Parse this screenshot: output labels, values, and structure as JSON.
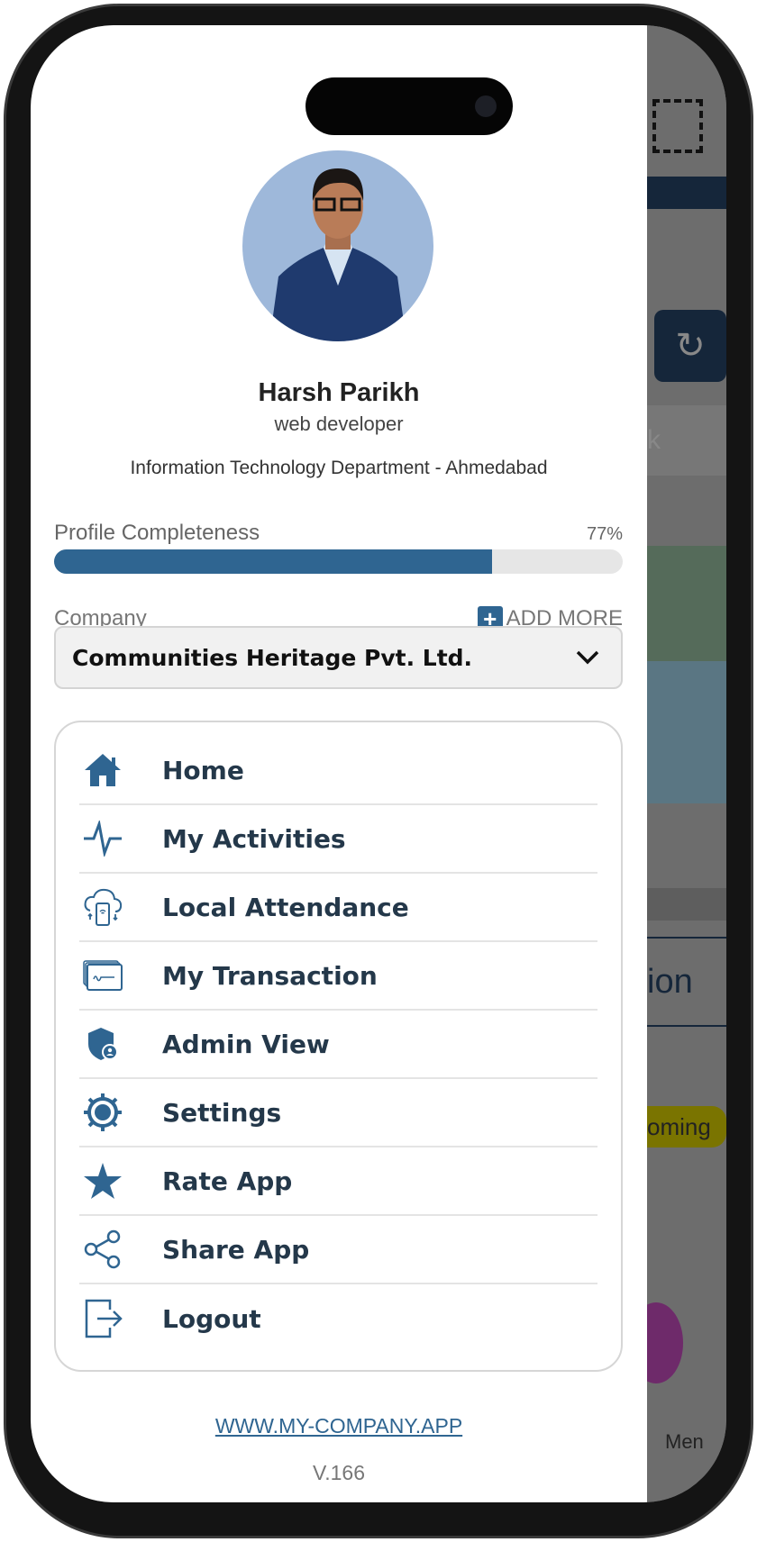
{
  "profile": {
    "name": "Harsh Parikh",
    "role": "web developer",
    "department": "Information Technology Department - Ahmedabad"
  },
  "completeness": {
    "label": "Profile Completeness",
    "value_text": "77%",
    "percent": 77
  },
  "company": {
    "label": "Company",
    "add_more": "ADD MORE",
    "selected": "Communities Heritage Pvt. Ltd."
  },
  "menu": [
    {
      "label": "Home",
      "icon": "home-icon"
    },
    {
      "label": "My Activities",
      "icon": "activity-icon"
    },
    {
      "label": "Local Attendance",
      "icon": "cloud-device-icon"
    },
    {
      "label": "My Transaction",
      "icon": "cards-icon"
    },
    {
      "label": "Admin View",
      "icon": "shield-user-icon"
    },
    {
      "label": "Settings",
      "icon": "gear-icon"
    },
    {
      "label": "Rate App",
      "icon": "star-icon"
    },
    {
      "label": "Share App",
      "icon": "share-icon"
    },
    {
      "label": "Logout",
      "icon": "logout-icon"
    }
  ],
  "footer": {
    "website": "WWW.MY-COMPANY.APP",
    "version": "V.166"
  },
  "background": {
    "tab_fragment": "k",
    "section_fragment": "ion",
    "badge_fragment": "oming",
    "nav_fragment": "Men"
  },
  "colors": {
    "accent": "#2f6591",
    "text": "#24384a",
    "avatar_bg": "#9eb8da"
  }
}
